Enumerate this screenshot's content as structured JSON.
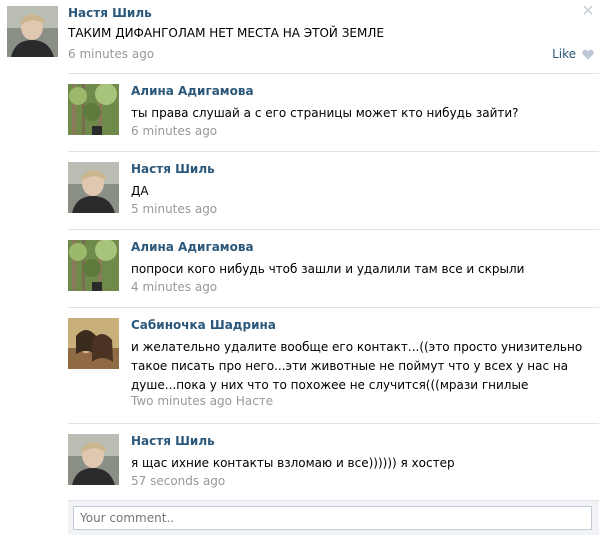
{
  "post": {
    "author": "Настя Шиль",
    "text": "ТАКИМ ДИФАНГОЛАМ НЕТ МЕСТА НА ЭТОЙ ЗЕМЛЕ",
    "time": "6 minutes ago",
    "like_label": "Like",
    "close_icon": "close-icon",
    "like_icon": "heart-icon"
  },
  "comments": [
    {
      "author": "Алина Адигамова",
      "text": "ты права слушай а с его страницы может кто нибудь зайти?",
      "time": "6 minutes ago",
      "avatar": "forest-avatar"
    },
    {
      "author": "Настя Шиль",
      "text": "ДА",
      "time": "5 minutes ago",
      "avatar": "boy-avatar"
    },
    {
      "author": "Алина Адигамова",
      "text": "попроси кого нибудь чтоб зашли и удалили там все и скрыли",
      "time": "4 minutes ago",
      "avatar": "forest-avatar"
    },
    {
      "author": "Сабиночка Шадрина",
      "text": "и желательно удалите вообще его контакт...((это просто унизительно такое писать про него...эти животные не поймут что у всех у нас на душе...пока у них что то похожее не случится(((мрази гнилые",
      "time": "Two minutes ago",
      "reply_to": "Насте",
      "avatar": "couple-avatar"
    },
    {
      "author": "Настя Шиль",
      "text": "я щас ихние контакты взломаю и все)))))) я хостер",
      "time": "57 seconds ago",
      "avatar": "boy-avatar"
    }
  ],
  "comment_box": {
    "placeholder": "Your comment.."
  },
  "colors": {
    "link": "#2b587a",
    "meta": "#999999",
    "divider": "#dee3ea"
  }
}
